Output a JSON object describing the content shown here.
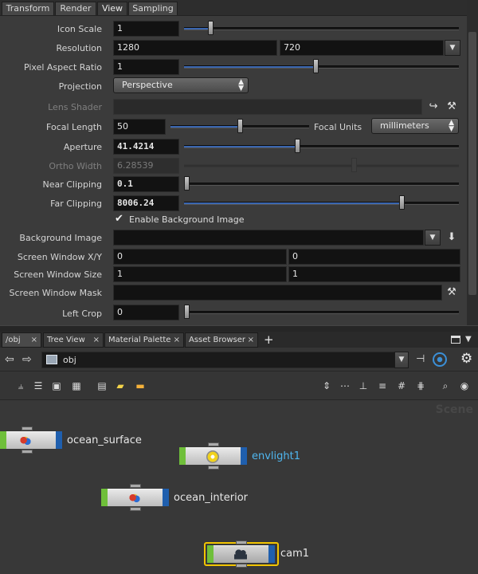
{
  "param_tabs": [
    "Transform",
    "Render",
    "View",
    "Sampling"
  ],
  "active_tab": "View",
  "params": {
    "icon_scale": {
      "label": "Icon Scale",
      "value": "1",
      "slider": 0.09
    },
    "resolution": {
      "label": "Resolution",
      "x": "1280",
      "y": "720"
    },
    "pixel_aspect": {
      "label": "Pixel Aspect Ratio",
      "value": "1",
      "slider": 0.48
    },
    "projection": {
      "label": "Projection",
      "value": "Perspective"
    },
    "lens_shader": {
      "label": "Lens Shader",
      "value": ""
    },
    "focal_length": {
      "label": "Focal Length",
      "value": "50",
      "slider": 0.5,
      "units_label": "Focal Units",
      "units_value": "millimeters"
    },
    "aperture": {
      "label": "Aperture",
      "value": "41.4214",
      "slider": 0.41
    },
    "ortho_width": {
      "label": "Ortho Width",
      "value": "6.28539",
      "slider": 0.62
    },
    "near_clipping": {
      "label": "Near Clipping",
      "value": "0.1",
      "slider": 0.0
    },
    "far_clipping": {
      "label": "Far Clipping",
      "value": "8006.24",
      "slider": 0.8
    },
    "enable_bg": {
      "label": "Enable Background Image",
      "checked": true
    },
    "background_image": {
      "label": "Background Image",
      "value": ""
    },
    "screen_window_xy": {
      "label": "Screen Window X/Y",
      "x": "0",
      "y": "0"
    },
    "screen_window_size": {
      "label": "Screen Window Size",
      "x": "1",
      "y": "1"
    },
    "screen_window_mask": {
      "label": "Screen Window Mask",
      "value": ""
    },
    "left_crop": {
      "label": "Left Crop",
      "value": "0",
      "slider": 0.0
    }
  },
  "network_tabs": [
    {
      "label": "/obj",
      "active": true
    },
    {
      "label": "Tree View",
      "active": false
    },
    {
      "label": "Material Palette",
      "active": false
    },
    {
      "label": "Asset Browser",
      "active": false
    }
  ],
  "add_tab_label": "+",
  "path": "obj",
  "context_label": "Scene",
  "nodes": [
    {
      "name": "ocean_surface",
      "kind": "geo",
      "selected": false
    },
    {
      "name": "envlight1",
      "kind": "light",
      "selected": false
    },
    {
      "name": "ocean_interior",
      "kind": "geo",
      "selected": false
    },
    {
      "name": "cam1",
      "kind": "camera",
      "selected": true
    }
  ],
  "colors": {
    "slider_fill": "#3a66b0",
    "node_flag_green": "#6fbf3a",
    "node_flag_blue": "#1f5fae",
    "light_name": "#4fb6ef",
    "selection": "#f2c400"
  },
  "icons": {
    "back": "back-arrow-icon",
    "forward": "forward-arrow-icon",
    "pin": "pin-icon",
    "link": "link-icon",
    "gear": "gear-icon"
  }
}
